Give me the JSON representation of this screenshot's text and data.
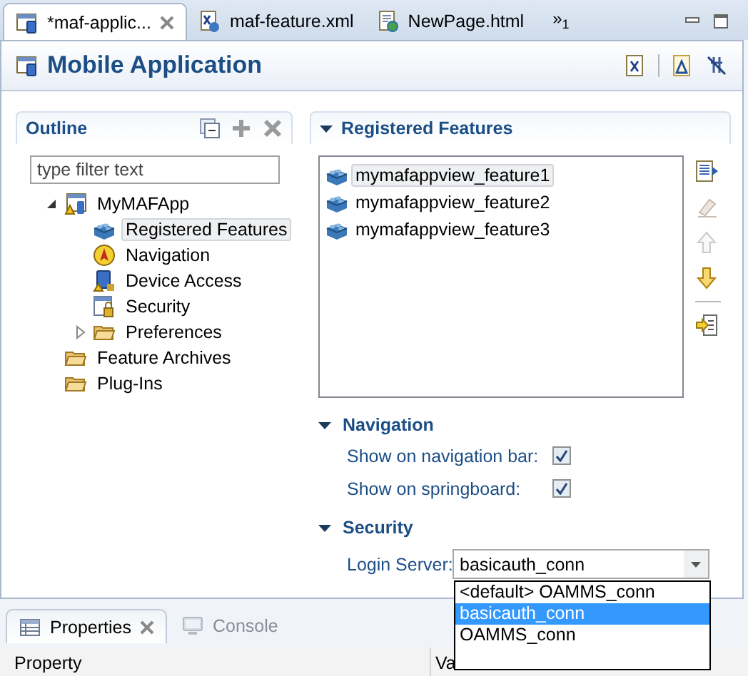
{
  "editor_tabs": [
    {
      "label": "*maf-applic...",
      "kind": "app",
      "selected": true
    },
    {
      "label": "maf-feature.xml",
      "kind": "xml",
      "selected": false
    },
    {
      "label": "NewPage.html",
      "kind": "html",
      "selected": false
    }
  ],
  "tab_overflow": {
    "symbol": "»",
    "count": "1"
  },
  "editor": {
    "title": "Mobile Application"
  },
  "outline": {
    "title": "Outline",
    "filter": {
      "placeholder": "type filter text"
    },
    "tree": [
      {
        "label": "MyMAFApp",
        "kind": "app",
        "expanded": true,
        "selected": false,
        "children": [
          {
            "label": "Registered Features",
            "kind": "feature",
            "selected": true
          },
          {
            "label": "Navigation",
            "kind": "navigation",
            "selected": false
          },
          {
            "label": "Device Access",
            "kind": "device",
            "selected": false
          },
          {
            "label": "Security",
            "kind": "security",
            "selected": false
          },
          {
            "label": "Preferences",
            "kind": "folder",
            "expanded": false,
            "selected": false
          }
        ]
      },
      {
        "label": "Feature Archives",
        "kind": "folder",
        "selected": false
      },
      {
        "label": "Plug-Ins",
        "kind": "folder",
        "selected": false
      }
    ]
  },
  "registered_features": {
    "title": "Registered Features",
    "expanded": true,
    "items": [
      {
        "label": "mymafappview_feature1",
        "selected": true
      },
      {
        "label": "mymafappview_feature2",
        "selected": false
      },
      {
        "label": "mymafappview_feature3",
        "selected": false
      }
    ],
    "tools": [
      {
        "kind": "add",
        "disabled": false
      },
      {
        "kind": "edit",
        "disabled": true
      },
      {
        "kind": "up",
        "disabled": true
      },
      {
        "kind": "down",
        "disabled": false
      },
      {
        "kind": "insert",
        "disabled": false
      }
    ]
  },
  "navigation": {
    "title": "Navigation",
    "expanded": true,
    "options": [
      {
        "label": "Show on navigation bar:",
        "checked": true
      },
      {
        "label": "Show on springboard:",
        "checked": true
      }
    ]
  },
  "security": {
    "title": "Security",
    "expanded": true,
    "login_server": {
      "label": "Login Server:",
      "value": "basicauth_conn",
      "open": true,
      "options": [
        {
          "label": "<default> OAMMS_conn",
          "selected": false
        },
        {
          "label": "basicauth_conn",
          "selected": true
        },
        {
          "label": "OAMMS_conn",
          "selected": false
        }
      ]
    }
  },
  "bottom_tabs": [
    {
      "label": "Properties",
      "kind": "table",
      "selected": true
    },
    {
      "label": "Console",
      "kind": "console",
      "selected": false
    }
  ],
  "properties_table": {
    "columns": [
      "Property",
      "Va"
    ]
  }
}
